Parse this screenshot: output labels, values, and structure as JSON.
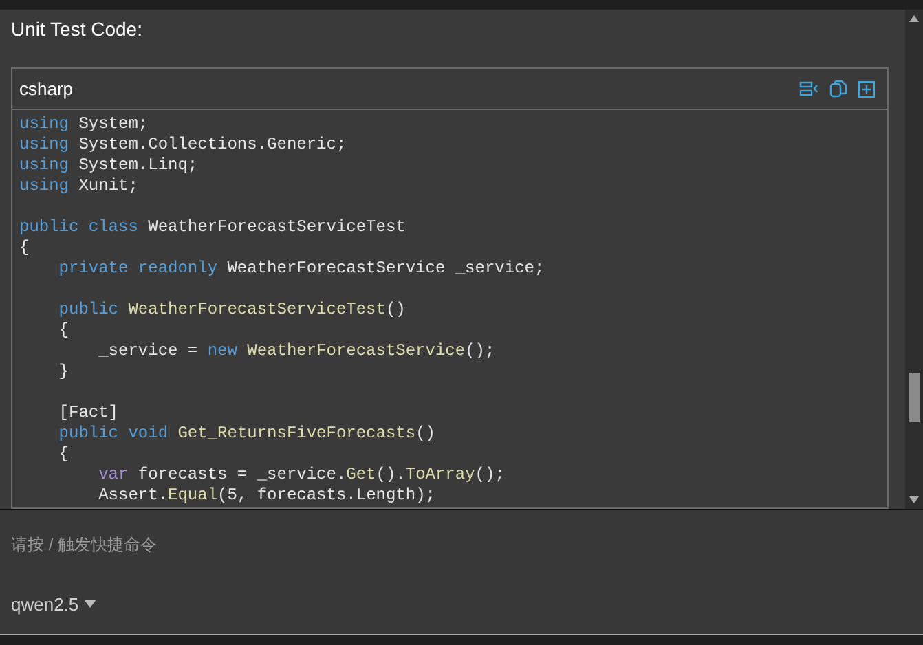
{
  "title": "Unit Test Code:",
  "code_block": {
    "language": "csharp",
    "lines": [
      {
        "kind": "code",
        "tokens": [
          {
            "text": "using",
            "kind": "keyword"
          },
          {
            "text": " System;",
            "kind": "plain"
          }
        ]
      },
      {
        "kind": "code",
        "tokens": [
          {
            "text": "using",
            "kind": "keyword"
          },
          {
            "text": " System.Collections.Generic;",
            "kind": "plain"
          }
        ]
      },
      {
        "kind": "code",
        "tokens": [
          {
            "text": "using",
            "kind": "keyword"
          },
          {
            "text": " System.Linq;",
            "kind": "plain"
          }
        ]
      },
      {
        "kind": "code",
        "tokens": [
          {
            "text": "using",
            "kind": "keyword"
          },
          {
            "text": " Xunit;",
            "kind": "plain"
          }
        ]
      },
      {
        "kind": "blank"
      },
      {
        "kind": "code",
        "tokens": [
          {
            "text": "public class",
            "kind": "keyword"
          },
          {
            "text": " WeatherForecastServiceTest",
            "kind": "plain"
          }
        ]
      },
      {
        "kind": "code",
        "tokens": [
          {
            "text": "{",
            "kind": "plain"
          }
        ]
      },
      {
        "kind": "code",
        "tokens": [
          {
            "text": "    private readonly",
            "kind": "keyword"
          },
          {
            "text": " WeatherForecastService _service;",
            "kind": "plain"
          }
        ]
      },
      {
        "kind": "blank"
      },
      {
        "kind": "code",
        "tokens": [
          {
            "text": "    public",
            "kind": "keyword"
          },
          {
            "text": " WeatherForecastServiceTest",
            "kind": "name"
          },
          {
            "text": "()",
            "kind": "plain"
          }
        ]
      },
      {
        "kind": "code",
        "tokens": [
          {
            "text": "    {",
            "kind": "plain"
          }
        ]
      },
      {
        "kind": "code",
        "tokens": [
          {
            "text": "        _service = ",
            "kind": "plain"
          },
          {
            "text": "new",
            "kind": "keyword"
          },
          {
            "text": " WeatherForecastService",
            "kind": "name"
          },
          {
            "text": "();",
            "kind": "plain"
          }
        ]
      },
      {
        "kind": "code",
        "tokens": [
          {
            "text": "    }",
            "kind": "plain"
          }
        ]
      },
      {
        "kind": "blank"
      },
      {
        "kind": "code",
        "tokens": [
          {
            "text": "    [Fact]",
            "kind": "plain"
          }
        ]
      },
      {
        "kind": "code",
        "tokens": [
          {
            "text": "    public void",
            "kind": "keyword"
          },
          {
            "text": " Get_ReturnsFiveForecasts",
            "kind": "name"
          },
          {
            "text": "()",
            "kind": "plain"
          }
        ]
      },
      {
        "kind": "code",
        "tokens": [
          {
            "text": "    {",
            "kind": "plain"
          }
        ]
      },
      {
        "kind": "code",
        "tokens": [
          {
            "text": "        var",
            "kind": "variable"
          },
          {
            "text": " forecasts = _service.",
            "kind": "plain"
          },
          {
            "text": "Get",
            "kind": "name"
          },
          {
            "text": "().",
            "kind": "plain"
          },
          {
            "text": "ToArray",
            "kind": "name"
          },
          {
            "text": "();",
            "kind": "plain"
          }
        ]
      },
      {
        "kind": "code",
        "tokens": [
          {
            "text": "        Assert.",
            "kind": "plain"
          },
          {
            "text": "Equal",
            "kind": "name"
          },
          {
            "text": "(5, forecasts.Length);",
            "kind": "plain"
          }
        ]
      }
    ]
  },
  "input": {
    "placeholder": "请按 / 触发快捷命令"
  },
  "model_select": {
    "value": "qwen2.5"
  }
}
